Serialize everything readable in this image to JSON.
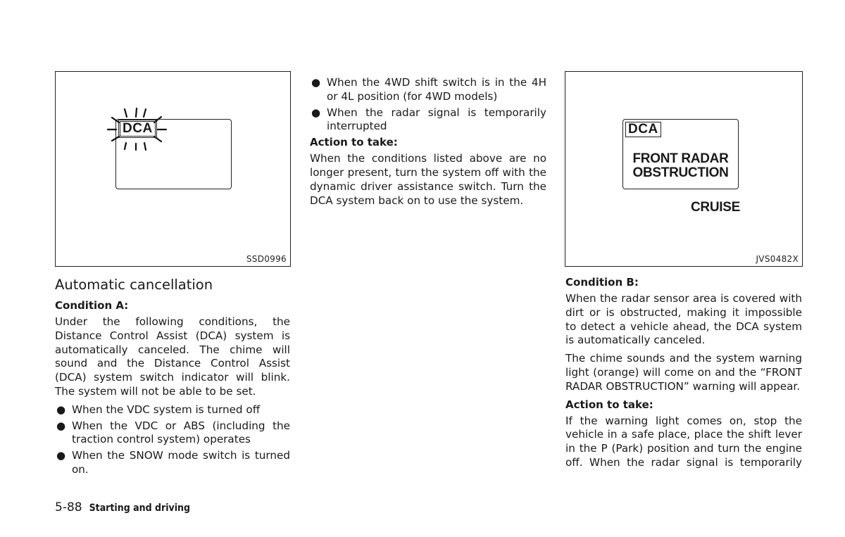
{
  "figures": {
    "left": {
      "code": "SSD0996",
      "indicator_label": "DCA",
      "indicator_state": "blinking"
    },
    "right": {
      "code": "JVS0482X",
      "indicator_label": "DCA",
      "message_line1": "FRONT RADAR",
      "message_line2": "OBSTRUCTION",
      "status_label": "CRUISE"
    }
  },
  "left_column": {
    "heading": "Automatic cancellation",
    "condition_a_heading": "Condition A:",
    "condition_a_text": "Under the following conditions, the Distance Control Assist (DCA) system is automatically canceled. The chime will sound and the Distance Control Assist (DCA) system switch indicator will blink. The system will not be able to be set.",
    "bullets": [
      "When the VDC system is turned off",
      "When the VDC or ABS (including the traction control system) operates",
      "When the SNOW mode switch is turned on."
    ]
  },
  "middle_column": {
    "bullets": [
      "When the 4WD shift switch is in the 4H or 4L position (for 4WD models)",
      "When the radar signal is temporarily interrupted"
    ],
    "action_heading": "Action to take:",
    "action_text": "When the conditions listed above are no longer present, turn the system off with the dynamic driver assistance switch. Turn the DCA system back on to use the system."
  },
  "right_column": {
    "condition_b_heading": "Condition B:",
    "condition_b_text": "When the radar sensor area is covered with dirt or is obstructed, making it impossible to detect a vehicle ahead, the DCA system is automatically canceled.",
    "chime_text": "The chime sounds and the system warning light (orange) will come on and the “FRONT RADAR OBSTRUCTION” warning will appear.",
    "action_heading": "Action to take:",
    "action_text": "If the warning light comes on, stop the vehicle in a safe place, place the shift lever in the P (Park) position and turn the engine off. When the radar signal is temporarily"
  },
  "footer": {
    "page_number": "5-88",
    "section_title": "Starting and driving"
  }
}
